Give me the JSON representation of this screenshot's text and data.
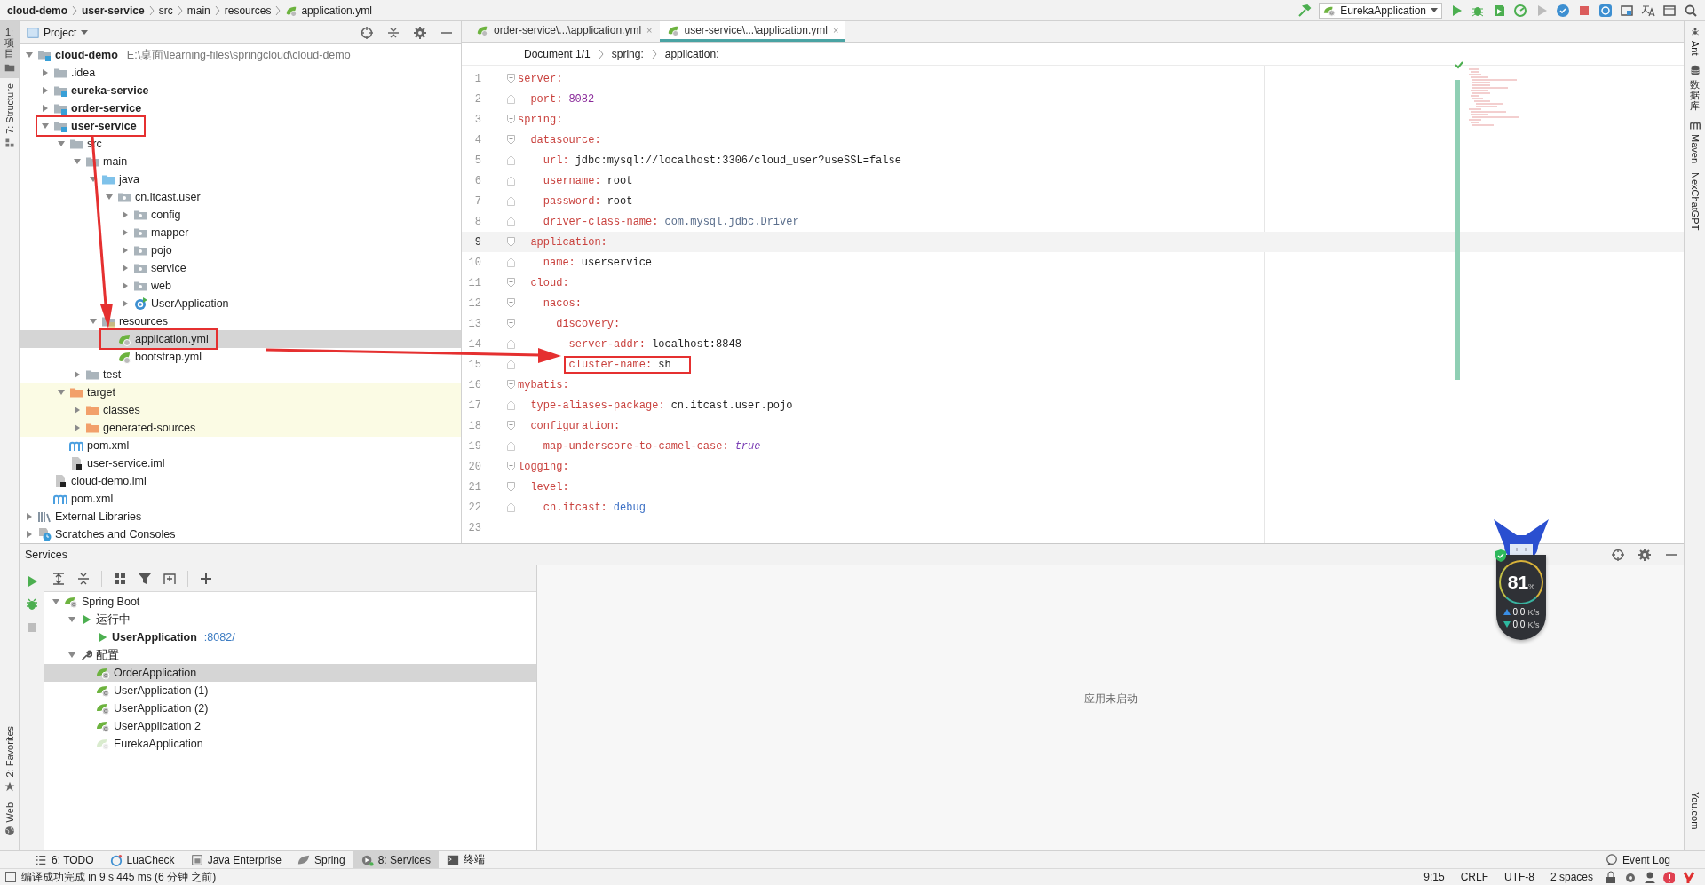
{
  "navigation_bar": {
    "breadcrumbs": [
      {
        "label": "cloud-demo",
        "kind": "project"
      },
      {
        "label": "user-service",
        "kind": "module"
      },
      {
        "label": "src",
        "kind": "folder"
      },
      {
        "label": "main",
        "kind": "folder"
      },
      {
        "label": "resources",
        "kind": "folder"
      },
      {
        "label": "application.yml",
        "kind": "yaml"
      }
    ],
    "run_configuration": "EurekaApplication"
  },
  "left_tool_strip": {
    "top": [
      {
        "label": "1: 项目",
        "kind": "project",
        "selected": true
      },
      {
        "label": "7: Structure",
        "kind": "structure",
        "selected": false
      }
    ],
    "bottom": [
      {
        "label": "2: Favorites",
        "kind": "favorites",
        "selected": false
      },
      {
        "label": "Web",
        "kind": "web",
        "selected": false
      }
    ]
  },
  "right_tool_strip": [
    {
      "label": "Ant",
      "kind": "ant"
    },
    {
      "label": "数据库",
      "kind": "database"
    },
    {
      "label": "Maven",
      "kind": "maven"
    },
    {
      "label": "NexChatGPT",
      "kind": "plain"
    },
    {
      "label": "You.com",
      "kind": "bottom"
    }
  ],
  "project_panel": {
    "title": "Project",
    "tree": [
      {
        "label": "cloud-demo",
        "kind": "project",
        "path": "E:\\桌面\\learning-files\\springcloud\\cloud-demo",
        "expanded": true,
        "selected": false,
        "children": [
          {
            "label": ".idea",
            "kind": "folder",
            "expanded": false,
            "selected": false
          },
          {
            "label": "eureka-service",
            "kind": "module",
            "expanded": false,
            "selected": false
          },
          {
            "label": "order-service",
            "kind": "module",
            "expanded": false,
            "selected": false
          },
          {
            "label": "user-service",
            "kind": "module",
            "expanded": true,
            "selected": false,
            "boxed": true,
            "children": [
              {
                "label": "src",
                "kind": "folder",
                "expanded": true,
                "selected": false,
                "children": [
                  {
                    "label": "main",
                    "kind": "folder",
                    "expanded": true,
                    "selected": false,
                    "children": [
                      {
                        "label": "java",
                        "kind": "source",
                        "expanded": true,
                        "selected": false,
                        "children": [
                          {
                            "label": "cn.itcast.user",
                            "kind": "package",
                            "expanded": true,
                            "selected": false,
                            "children": [
                              {
                                "label": "config",
                                "kind": "package",
                                "expanded": false,
                                "selected": false
                              },
                              {
                                "label": "mapper",
                                "kind": "package",
                                "expanded": false,
                                "selected": false
                              },
                              {
                                "label": "pojo",
                                "kind": "package",
                                "expanded": false,
                                "selected": false
                              },
                              {
                                "label": "service",
                                "kind": "package",
                                "expanded": false,
                                "selected": false
                              },
                              {
                                "label": "web",
                                "kind": "package",
                                "expanded": false,
                                "selected": false
                              },
                              {
                                "label": "UserApplication",
                                "kind": "class",
                                "expanded": false,
                                "selected": false
                              }
                            ]
                          }
                        ]
                      },
                      {
                        "label": "resources",
                        "kind": "resources",
                        "expanded": true,
                        "selected": false,
                        "children": [
                          {
                            "label": "application.yml",
                            "kind": "yaml",
                            "selected": true,
                            "boxed": true
                          },
                          {
                            "label": "bootstrap.yml",
                            "kind": "yaml",
                            "selected": false
                          }
                        ]
                      }
                    ]
                  },
                  {
                    "label": "test",
                    "kind": "folder",
                    "expanded": false,
                    "selected": false
                  }
                ]
              },
              {
                "label": "target",
                "kind": "excluded",
                "expanded": true,
                "selected": false,
                "excluded": true,
                "children": [
                  {
                    "label": "classes",
                    "kind": "excluded",
                    "expanded": false,
                    "selected": false,
                    "excluded": true
                  },
                  {
                    "label": "generated-sources",
                    "kind": "excluded",
                    "expanded": false,
                    "selected": false,
                    "excluded": true
                  }
                ]
              },
              {
                "label": "pom.xml",
                "kind": "maven",
                "selected": false
              },
              {
                "label": "user-service.iml",
                "kind": "iml",
                "selected": false
              }
            ]
          },
          {
            "label": "cloud-demo.iml",
            "kind": "iml",
            "selected": false
          },
          {
            "label": "pom.xml",
            "kind": "maven",
            "selected": false
          }
        ]
      },
      {
        "label": "External Libraries",
        "kind": "libraries",
        "expanded": false,
        "selected": false
      },
      {
        "label": "Scratches and Consoles",
        "kind": "scratches",
        "expanded": false,
        "selected": false
      }
    ]
  },
  "editor": {
    "tabs": [
      {
        "label": "order-service\\...\\application.yml",
        "close": "×",
        "selected": false
      },
      {
        "label": "user-service\\...\\application.yml",
        "close": "×",
        "selected": true
      }
    ],
    "breadcrumbs": [
      "Document 1/1",
      "spring:",
      "application:"
    ],
    "lines": [
      {
        "number": "1",
        "key": "server:",
        "current": false
      },
      {
        "number": "2",
        "key": "  port:",
        "value": "8082",
        "kind": "number",
        "current": false
      },
      {
        "number": "3",
        "key": "spring:",
        "current": false
      },
      {
        "number": "4",
        "key": "  datasource:",
        "current": false
      },
      {
        "number": "5",
        "key": "    url:",
        "value": "jdbc:mysql://localhost:3306/cloud_user?useSSL=false",
        "kind": "text",
        "current": false
      },
      {
        "number": "6",
        "key": "    username:",
        "value": "root",
        "kind": "text",
        "current": false
      },
      {
        "number": "7",
        "key": "    password:",
        "value": "root",
        "kind": "text",
        "current": false
      },
      {
        "number": "8",
        "key": "    driver-class-name:",
        "value": "com.mysql.jdbc.Driver",
        "kind": "constant",
        "current": false
      },
      {
        "number": "9",
        "key": "  application:",
        "current": true
      },
      {
        "number": "10",
        "key": "    name:",
        "value": "userservice",
        "kind": "text",
        "current": false
      },
      {
        "number": "11",
        "key": "  cloud:",
        "current": false
      },
      {
        "number": "12",
        "key": "    nacos:",
        "current": false
      },
      {
        "number": "13",
        "key": "      discovery:",
        "current": false
      },
      {
        "number": "14",
        "key": "        server-addr:",
        "value": "localhost:8848",
        "kind": "text",
        "current": false
      },
      {
        "number": "15",
        "key": "        cluster-name:",
        "value": "sh",
        "kind": "text",
        "current": false,
        "boxed": true
      },
      {
        "number": "16",
        "key": "mybatis:",
        "current": false
      },
      {
        "number": "17",
        "key": "  type-aliases-package:",
        "value": "cn.itcast.user.pojo",
        "kind": "text",
        "current": false
      },
      {
        "number": "18",
        "key": "  configuration:",
        "current": false
      },
      {
        "number": "19",
        "key": "    map-underscore-to-camel-case:",
        "value": "true",
        "kind": "bool",
        "current": false
      },
      {
        "number": "20",
        "key": "logging:",
        "current": false
      },
      {
        "number": "21",
        "key": "  level:",
        "current": false
      },
      {
        "number": "22",
        "key": "    cn.itcast:",
        "value": "debug",
        "kind": "enum",
        "current": false
      },
      {
        "number": "23",
        "current": false
      }
    ]
  },
  "services": {
    "title": "Services",
    "tree": [
      {
        "label": "Spring Boot",
        "kind": "group",
        "expanded": true,
        "selected": false,
        "children": [
          {
            "label": "运行中",
            "kind": "status",
            "expanded": true,
            "selected": false,
            "children": [
              {
                "label": "UserApplication",
                "kind": "running",
                "port": ":8082/",
                "selected": false
              }
            ]
          },
          {
            "label": "配置",
            "kind": "config-group",
            "expanded": true,
            "selected": false,
            "children": [
              {
                "label": "OrderApplication",
                "kind": "config",
                "active": true,
                "selected": true
              },
              {
                "label": "UserApplication (1)",
                "kind": "config",
                "active": true,
                "selected": false
              },
              {
                "label": "UserApplication (2)",
                "kind": "config",
                "active": true,
                "selected": false
              },
              {
                "label": "UserApplication 2",
                "kind": "config",
                "active": true,
                "selected": false
              },
              {
                "label": "EurekaApplication",
                "kind": "config",
                "active": false,
                "selected": false
              }
            ]
          }
        ]
      }
    ],
    "empty_message": "应用未启动"
  },
  "tool_window_tabs": [
    {
      "label": "6: TODO",
      "kind": "todo",
      "selected": false
    },
    {
      "label": "LuaCheck",
      "kind": "luacheck",
      "selected": false
    },
    {
      "label": "Java Enterprise",
      "kind": "javaee",
      "selected": false
    },
    {
      "label": "Spring",
      "kind": "spring",
      "selected": false
    },
    {
      "label": "8: Services",
      "kind": "services",
      "selected": true
    },
    {
      "label": "终端",
      "kind": "terminal",
      "selected": false
    }
  ],
  "event_log": "Event Log",
  "status_bar": {
    "message": "编译成功完成 in 9 s 445 ms (6 分钟 之前)",
    "items": [
      "9:15",
      "CRLF",
      "UTF-8",
      "2 spaces"
    ]
  },
  "monitor_widget": {
    "value": "81",
    "unit": "%",
    "upload": "0.0",
    "upload_unit": "K/s",
    "download": "0.0",
    "download_unit": "K/s"
  }
}
